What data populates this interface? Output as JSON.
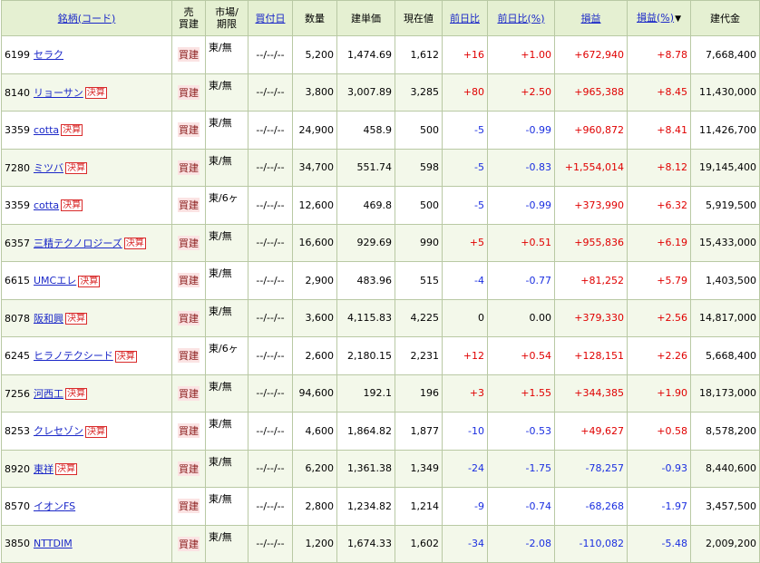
{
  "header": {
    "name": "銘柄(コード)",
    "side_top": "売",
    "side_bottom": "買建",
    "market_top": "市場/",
    "market_bottom": "期限",
    "date": "買付日",
    "qty": "数量",
    "cost": "建単価",
    "price": "現在値",
    "chg": "前日比",
    "chgpct": "前日比(%)",
    "pl": "損益",
    "plpct": "損益(%)",
    "sort_icon": "▼",
    "amount": "建代金"
  },
  "kessan_label": "決算",
  "rows": [
    {
      "code": "6199",
      "name": "セラク",
      "kessan": "",
      "side": "買建",
      "market": "東/無",
      "date": "--/--/--",
      "qty": "5,200",
      "cost": "1,474.69",
      "price": "1,612",
      "chg": "+16",
      "chgpct": "+1.00",
      "pl": "+672,940",
      "plpct": "+8.78",
      "amount": "7,668,400"
    },
    {
      "code": "8140",
      "name": "リョーサン",
      "kessan": "決算",
      "side": "買建",
      "market": "東/無",
      "date": "--/--/--",
      "qty": "3,800",
      "cost": "3,007.89",
      "price": "3,285",
      "chg": "+80",
      "chgpct": "+2.50",
      "pl": "+965,388",
      "plpct": "+8.45",
      "amount": "11,430,000"
    },
    {
      "code": "3359",
      "name": "cotta",
      "kessan": "決算",
      "side": "買建",
      "market": "東/無",
      "date": "--/--/--",
      "qty": "24,900",
      "cost": "458.9",
      "price": "500",
      "chg": "-5",
      "chgpct": "-0.99",
      "pl": "+960,872",
      "plpct": "+8.41",
      "amount": "11,426,700"
    },
    {
      "code": "7280",
      "name": "ミツバ",
      "kessan": "決算",
      "side": "買建",
      "market": "東/無",
      "date": "--/--/--",
      "qty": "34,700",
      "cost": "551.74",
      "price": "598",
      "chg": "-5",
      "chgpct": "-0.83",
      "pl": "+1,554,014",
      "plpct": "+8.12",
      "amount": "19,145,400"
    },
    {
      "code": "3359",
      "name": "cotta",
      "kessan": "決算",
      "side": "買建",
      "market": "東/6ヶ",
      "date": "--/--/--",
      "qty": "12,600",
      "cost": "469.8",
      "price": "500",
      "chg": "-5",
      "chgpct": "-0.99",
      "pl": "+373,990",
      "plpct": "+6.32",
      "amount": "5,919,500"
    },
    {
      "code": "6357",
      "name": "三精テクノロジーズ",
      "kessan": "決算",
      "side": "買建",
      "market": "東/無",
      "date": "--/--/--",
      "qty": "16,600",
      "cost": "929.69",
      "price": "990",
      "chg": "+5",
      "chgpct": "+0.51",
      "pl": "+955,836",
      "plpct": "+6.19",
      "amount": "15,433,000"
    },
    {
      "code": "6615",
      "name": "UMCエレ",
      "kessan": "決算",
      "side": "買建",
      "market": "東/無",
      "date": "--/--/--",
      "qty": "2,900",
      "cost": "483.96",
      "price": "515",
      "chg": "-4",
      "chgpct": "-0.77",
      "pl": "+81,252",
      "plpct": "+5.79",
      "amount": "1,403,500"
    },
    {
      "code": "8078",
      "name": "阪和興",
      "kessan": "決算",
      "side": "買建",
      "market": "東/無",
      "date": "--/--/--",
      "qty": "3,600",
      "cost": "4,115.83",
      "price": "4,225",
      "chg": "0",
      "chgpct": "0.00",
      "pl": "+379,330",
      "plpct": "+2.56",
      "amount": "14,817,000"
    },
    {
      "code": "6245",
      "name": "ヒラノテクシード",
      "kessan": "決算",
      "side": "買建",
      "market": "東/6ヶ",
      "date": "--/--/--",
      "qty": "2,600",
      "cost": "2,180.15",
      "price": "2,231",
      "chg": "+12",
      "chgpct": "+0.54",
      "pl": "+128,151",
      "plpct": "+2.26",
      "amount": "5,668,400"
    },
    {
      "code": "7256",
      "name": "河西工",
      "kessan": "決算",
      "side": "買建",
      "market": "東/無",
      "date": "--/--/--",
      "qty": "94,600",
      "cost": "192.1",
      "price": "196",
      "chg": "+3",
      "chgpct": "+1.55",
      "pl": "+344,385",
      "plpct": "+1.90",
      "amount": "18,173,000"
    },
    {
      "code": "8253",
      "name": "クレセゾン",
      "kessan": "決算",
      "side": "買建",
      "market": "東/無",
      "date": "--/--/--",
      "qty": "4,600",
      "cost": "1,864.82",
      "price": "1,877",
      "chg": "-10",
      "chgpct": "-0.53",
      "pl": "+49,627",
      "plpct": "+0.58",
      "amount": "8,578,200"
    },
    {
      "code": "8920",
      "name": "東祥",
      "kessan": "決算",
      "side": "買建",
      "market": "東/無",
      "date": "--/--/--",
      "qty": "6,200",
      "cost": "1,361.38",
      "price": "1,349",
      "chg": "-24",
      "chgpct": "-1.75",
      "pl": "-78,257",
      "plpct": "-0.93",
      "amount": "8,440,600"
    },
    {
      "code": "8570",
      "name": "イオンFS",
      "kessan": "",
      "side": "買建",
      "market": "東/無",
      "date": "--/--/--",
      "qty": "2,800",
      "cost": "1,234.82",
      "price": "1,214",
      "chg": "-9",
      "chgpct": "-0.74",
      "pl": "-68,268",
      "plpct": "-1.97",
      "amount": "3,457,500"
    },
    {
      "code": "3850",
      "name": "NTTDIM",
      "kessan": "",
      "side": "買建",
      "market": "東/無",
      "date": "--/--/--",
      "qty": "1,200",
      "cost": "1,674.33",
      "price": "1,602",
      "chg": "-34",
      "chgpct": "-2.08",
      "pl": "-110,082",
      "plpct": "-5.48",
      "amount": "2,009,200"
    }
  ]
}
